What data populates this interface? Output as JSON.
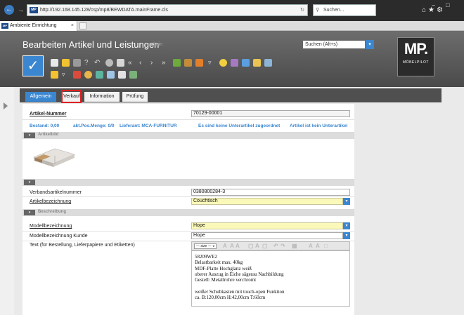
{
  "browser": {
    "url": "http://192.168.145.128/csp/mp8/BEWDATA.mainFrame.cls",
    "search_placeholder": "Suchen...",
    "tab_title": "Ambiente Einrichtung",
    "tab_close": "×"
  },
  "app": {
    "title": "Bearbeiten Artikel und Leistungen",
    "user": "admin",
    "search_value": "Suchen (Alt+s)",
    "logo_main": "MP.",
    "logo_sub": "MÖBELPILOT"
  },
  "tabs": [
    {
      "label": "Allgemein"
    },
    {
      "label": "Verkauf"
    },
    {
      "label": "Information"
    },
    {
      "label": "Prüfung"
    }
  ],
  "form": {
    "artikel_nummer_label": "Artikel-Nummer",
    "artikel_nummer_value": "70129-00001",
    "info": {
      "bestand": "Bestand: 0,00",
      "pos_menge": "akt.Pos.Menge: 0/0",
      "lieferant": "Lieferant: MCA-FURNITUR",
      "unterartikel": "Es sind keine Unterartikel zugeordnet",
      "kein_unterartikel": "Artikel ist kein Unterartikel"
    },
    "section_artikelbild": "Artikelbild",
    "verbandsartikelnummer_label": "Verbandsartikelnummer",
    "verbandsartikelnummer_value": "0380800284-3",
    "artikelbezeichnung_label": "Artikelbezeichnung",
    "artikelbezeichnung_value": "Couchtisch",
    "section_beschreibung": "Beschreibung",
    "modellbezeichnung_label": "Modellbezeichnung",
    "modellbezeichnung_value": "Hope",
    "modellbezeichnung_kunde_label": "Modellbezeichnung Kunde",
    "modellbezeichnung_kunde_value": "Hope",
    "text_label": "Text (für Bestellung, Lieferpapiere und Etiketten)",
    "editor_font": "— size — ∨",
    "text_lines": [
      "58209WE2",
      "Belastbarkeit max. 40kg",
      "MDF-Platte Hochglanz weiß",
      "oberer Auszug in Eiche sägerau Nachbildung",
      "Gestell: Metallrohre verchromt",
      "",
      "weißer Schubkasten mit touch-open Funktion",
      "ca. B:120,00cm H:42,00cm T:60cm"
    ]
  },
  "colors": {
    "accent": "#3a86d0",
    "highlight": "#e02020",
    "required_field": "#fbf9b9"
  }
}
